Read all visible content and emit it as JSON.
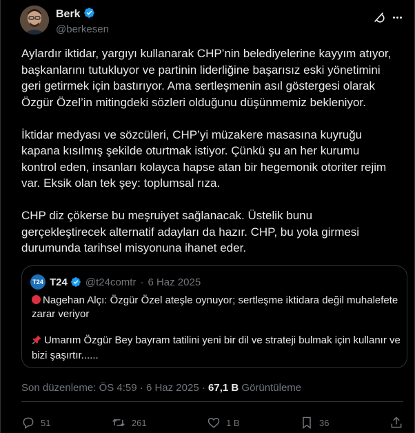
{
  "author": {
    "display_name": "Berk",
    "handle": "@berkesen",
    "verified": true
  },
  "tweet": {
    "paragraphs": [
      "Aylardır iktidar, yargıyı kullanarak CHP’nin belediyelerine kayyım atıyor, başkanlarını tutukluyor ve partinin liderliğine başarısız eski yönetimini geri getirmek için bastırıyor. Ama sertleşmenin asıl göstergesi olarak Özgür Özel’in mitingdeki sözleri olduğunu düşünmemiz bekleniyor.",
      "İktidar medyası ve sözcüleri, CHP’yi müzakere masasına kuyruğu kapana kısılmış şekilde oturtmak istiyor. Çünkü şu an her kurumu kontrol eden, insanları kolayca hapse atan bir hegemonik otoriter rejim var. Eksik olan tek şey: toplumsal rıza.",
      "CHP diz çökerse bu meşruiyet sağlanacak. Üstelik bunu gerçekleştirecek alternatif adayları da hazır. CHP, bu yola girmesi durumunda tarihsel misyonuna ihanet eder."
    ]
  },
  "quote": {
    "logo_text": "T24",
    "display_name": "T24",
    "handle": "@t24comtr",
    "separator": "·",
    "date": "6 Haz 2025",
    "line1": "Nagehan Alçı: Özgür Özel ateşle oynuyor; sertleşme iktidara değil muhalefete zarar veriyor",
    "line2": "Umarım Özgür Bey bayram tatilini yeni bir dil ve strateji bulmak için kullanır ve bizi şaşırtır......"
  },
  "meta": {
    "edited_label": "Son düzenleme: ÖS 4:59",
    "separator": "·",
    "date": "6 Haz 2025",
    "separator2": "·",
    "views_count": "67,1 B",
    "views_label": "Görüntüleme"
  },
  "actions": {
    "replies": "51",
    "reposts": "261",
    "likes": "1 B",
    "bookmarks": "36"
  },
  "colors": {
    "background": "#000000",
    "text": "#e7e9ea",
    "muted": "#71767b",
    "border": "#2f3336",
    "verified": "#1d9bf0",
    "red_dot": "#dd2e44"
  },
  "icons": [
    "grok-icon",
    "more-icon",
    "verified-badge-icon",
    "reply-icon",
    "repost-icon",
    "like-icon",
    "bookmark-icon",
    "share-icon",
    "pushpin-icon"
  ]
}
